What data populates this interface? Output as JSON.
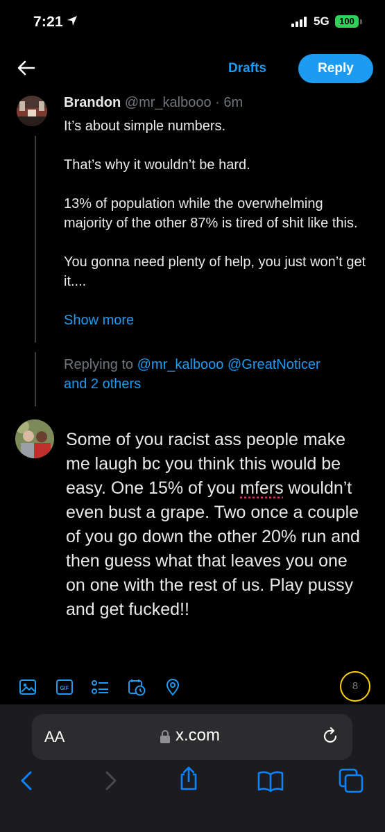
{
  "status_bar": {
    "time": "7:21",
    "network": "5G",
    "battery": "100"
  },
  "header": {
    "drafts_label": "Drafts",
    "reply_label": "Reply"
  },
  "original_tweet": {
    "author_name": "Brandon",
    "author_meta": "@mr_kalbooo · 6m",
    "body": "It’s about simple numbers.\n\nThat’s why it wouldn’t be hard.\n\n13% of population while the overwhelming majority of the other 87% is tired of shit like this.\n\nYou gonna need plenty of help, you just won’t get it....",
    "show_more": "Show more"
  },
  "replying": {
    "prefix": "Replying to",
    "mentions": "@mr_kalbooo @GreatNoticer",
    "others": "and 2 others"
  },
  "composer": {
    "text_before": "Some of you racist ass people make me laugh bc you think this would be easy. One 15% of you ",
    "misspelled_word": "mfers",
    "text_after": " wouldn’t even bust a grape. Two once a couple of you go down the other 20% run and then guess what that leaves you one on one with the rest of us. Play pussy and get fucked!!"
  },
  "toolbar": {
    "icons": [
      "image-icon",
      "gif-icon",
      "poll-icon",
      "schedule-icon",
      "location-icon"
    ],
    "remaining_count": "8",
    "accent_color": "#1d9bf0",
    "counter_color": "#ffd400"
  },
  "browser": {
    "aa_label": "AA",
    "url": "x.com"
  }
}
